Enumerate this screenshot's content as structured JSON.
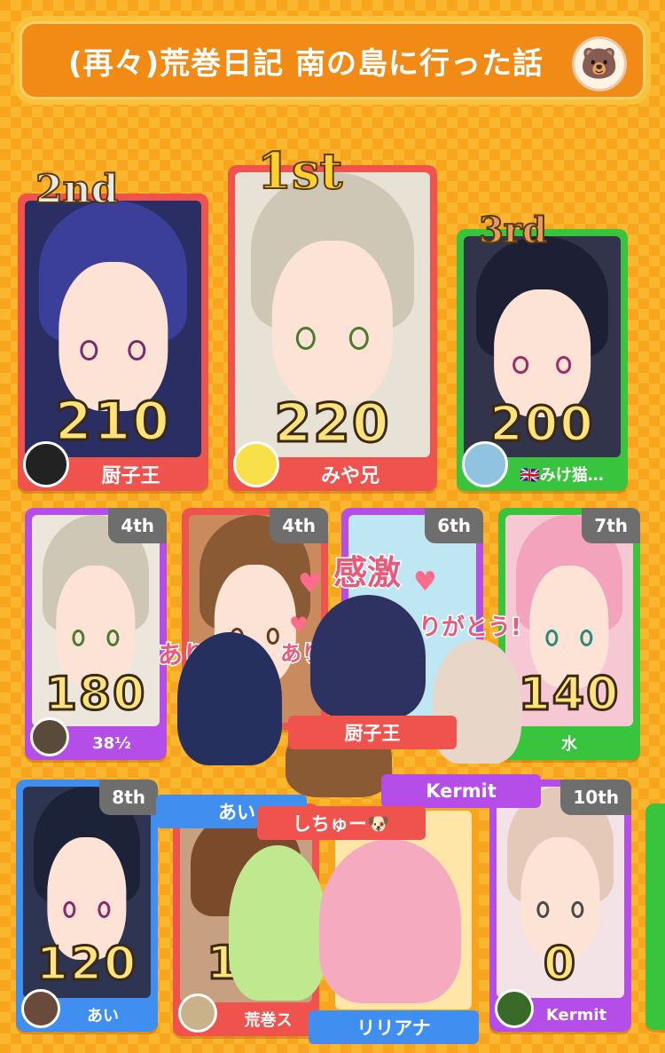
{
  "header": {
    "title": "(再々)荒巻日記 南の島に行った話",
    "bear_icon": "bear-face-icon"
  },
  "podium": [
    {
      "rank": "2nd",
      "score": "210",
      "player": "厨子王",
      "color": "#f0524e"
    },
    {
      "rank": "1st",
      "score": "220",
      "player": "みや兄",
      "color": "#f0524e"
    },
    {
      "rank": "3rd",
      "score": "200",
      "player": "🇬🇧みけ猫…",
      "color": "#38c43c"
    }
  ],
  "ranks": [
    {
      "rank": "4th",
      "score": "180",
      "player": "38½",
      "color": "#b54ee8"
    },
    {
      "rank": "4th",
      "score": "",
      "player": "",
      "color": "#f0524e"
    },
    {
      "rank": "6th",
      "score": "",
      "player": "Kermit",
      "color": "#b54ee8"
    },
    {
      "rank": "7th",
      "score": "140",
      "player": "水",
      "color": "#38c43c"
    },
    {
      "rank": "8th",
      "score": "120",
      "player": "あい",
      "color": "#3f8ef0"
    },
    {
      "rank": "",
      "score": "11",
      "player": "荒巻ス",
      "color": "#f0524e"
    },
    {
      "rank": "",
      "score": "",
      "player": "",
      "color": "#f6a51c"
    },
    {
      "rank": "10th",
      "score": "0",
      "player": "Kermit",
      "color": "#b54ee8"
    }
  ],
  "stamps": {
    "stamp1_text": "感激",
    "stamp1_sub": "りがとう!",
    "stamp1_name": "厨子王",
    "stamp2_text": "あり",
    "stamp2_sub": "あり",
    "stamp2_name": "あい",
    "stamp3_name": "しちゅー🐶",
    "stamp4_name": "リリアナ"
  },
  "colors": {
    "accent": "#f28a16",
    "red": "#f0524e",
    "purple": "#b54ee8",
    "green": "#38c43c",
    "blue": "#3f8ef0"
  }
}
